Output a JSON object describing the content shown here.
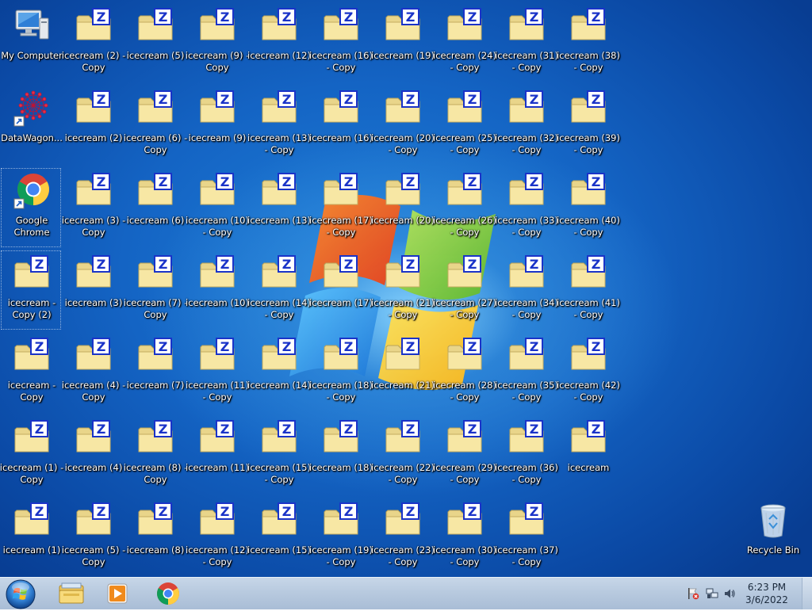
{
  "desktop": {
    "system_icons": [
      {
        "name": "my-computer-icon",
        "label": "My Computer",
        "glyph": "computer",
        "col": 0,
        "row": 0
      },
      {
        "name": "datawagon-shortcut-icon",
        "label": "DataWagon...",
        "glyph": "datawagon",
        "col": 0,
        "row": 1
      },
      {
        "name": "google-chrome-shortcut-icon",
        "label": "Google Chrome",
        "glyph": "chrome",
        "col": 0,
        "row": 2,
        "selected": true
      },
      {
        "name": "recycle-bin-icon",
        "label": "Recycle Bin",
        "glyph": "recycle-bin",
        "col": 12,
        "row": 6
      }
    ],
    "folder_glyph": "zip-folder-icon",
    "folders": [
      [
        {
          "col": 0,
          "row": 3,
          "label": "icecream - Copy (2)",
          "selected": true
        },
        {
          "col": 0,
          "row": 4,
          "label": "icecream - Copy"
        },
        {
          "col": 0,
          "row": 5,
          "label": "icecream (1) - Copy"
        },
        {
          "col": 0,
          "row": 6,
          "label": "icecream (1)"
        }
      ],
      [
        {
          "col": 1,
          "row": 0,
          "label": "icecream (2) - Copy"
        },
        {
          "col": 1,
          "row": 1,
          "label": "icecream (2)"
        },
        {
          "col": 1,
          "row": 2,
          "label": "icecream (3) - Copy"
        },
        {
          "col": 1,
          "row": 3,
          "label": "icecream (3)"
        },
        {
          "col": 1,
          "row": 4,
          "label": "icecream (4) - Copy"
        },
        {
          "col": 1,
          "row": 5,
          "label": "icecream (4)"
        },
        {
          "col": 1,
          "row": 6,
          "label": "icecream (5) - Copy"
        }
      ],
      [
        {
          "col": 2,
          "row": 0,
          "label": "icecream (5)"
        },
        {
          "col": 2,
          "row": 1,
          "label": "icecream (6) - Copy"
        },
        {
          "col": 2,
          "row": 2,
          "label": "icecream (6)"
        },
        {
          "col": 2,
          "row": 3,
          "label": "icecream (7) - Copy"
        },
        {
          "col": 2,
          "row": 4,
          "label": "icecream (7)"
        },
        {
          "col": 2,
          "row": 5,
          "label": "icecream (8) - Copy"
        },
        {
          "col": 2,
          "row": 6,
          "label": "icecream (8)"
        }
      ],
      [
        {
          "col": 3,
          "row": 0,
          "label": "icecream (9) - Copy"
        },
        {
          "col": 3,
          "row": 1,
          "label": "icecream (9)"
        },
        {
          "col": 3,
          "row": 2,
          "label": "icecream (10) - Copy"
        },
        {
          "col": 3,
          "row": 3,
          "label": "icecream (10)"
        },
        {
          "col": 3,
          "row": 4,
          "label": "icecream (11) - Copy"
        },
        {
          "col": 3,
          "row": 5,
          "label": "icecream (11)"
        },
        {
          "col": 3,
          "row": 6,
          "label": "icecream (12) - Copy"
        }
      ],
      [
        {
          "col": 4,
          "row": 0,
          "label": "icecream (12)"
        },
        {
          "col": 4,
          "row": 1,
          "label": "icecream (13) - Copy"
        },
        {
          "col": 4,
          "row": 2,
          "label": "icecream (13)"
        },
        {
          "col": 4,
          "row": 3,
          "label": "icecream (14) - Copy"
        },
        {
          "col": 4,
          "row": 4,
          "label": "icecream (14)"
        },
        {
          "col": 4,
          "row": 5,
          "label": "icecream (15) - Copy"
        },
        {
          "col": 4,
          "row": 6,
          "label": "icecream (15)"
        }
      ],
      [
        {
          "col": 5,
          "row": 0,
          "label": "icecream (16) - Copy"
        },
        {
          "col": 5,
          "row": 1,
          "label": "icecream (16)"
        },
        {
          "col": 5,
          "row": 2,
          "label": "icecream (17) - Copy"
        },
        {
          "col": 5,
          "row": 3,
          "label": "icecream (17)"
        },
        {
          "col": 5,
          "row": 4,
          "label": "icecream (18) - Copy"
        },
        {
          "col": 5,
          "row": 5,
          "label": "icecream (18)"
        },
        {
          "col": 5,
          "row": 6,
          "label": "icecream (19) - Copy"
        }
      ],
      [
        {
          "col": 6,
          "row": 0,
          "label": "icecream (19)"
        },
        {
          "col": 6,
          "row": 1,
          "label": "icecream (20) - Copy"
        },
        {
          "col": 6,
          "row": 2,
          "label": "icecream (20)"
        },
        {
          "col": 6,
          "row": 3,
          "label": "icecream (21) - Copy"
        },
        {
          "col": 6,
          "row": 4,
          "label": "icecream (21)"
        },
        {
          "col": 6,
          "row": 5,
          "label": "icecream (22) - Copy"
        },
        {
          "col": 6,
          "row": 6,
          "label": "icecream (23) - Copy"
        }
      ],
      [
        {
          "col": 7,
          "row": 0,
          "label": "icecream (24) - Copy"
        },
        {
          "col": 7,
          "row": 1,
          "label": "icecream (25) - Copy"
        },
        {
          "col": 7,
          "row": 2,
          "label": "icecream (26) - Copy"
        },
        {
          "col": 7,
          "row": 3,
          "label": "icecream (27) - Copy"
        },
        {
          "col": 7,
          "row": 4,
          "label": "icecream (28) - Copy"
        },
        {
          "col": 7,
          "row": 5,
          "label": "icecream (29) - Copy"
        },
        {
          "col": 7,
          "row": 6,
          "label": "icecream (30) - Copy"
        }
      ],
      [
        {
          "col": 8,
          "row": 0,
          "label": "icecream (31) - Copy"
        },
        {
          "col": 8,
          "row": 1,
          "label": "icecream (32) - Copy"
        },
        {
          "col": 8,
          "row": 2,
          "label": "icecream (33) - Copy"
        },
        {
          "col": 8,
          "row": 3,
          "label": "icecream (34) - Copy"
        },
        {
          "col": 8,
          "row": 4,
          "label": "icecream (35) - Copy"
        },
        {
          "col": 8,
          "row": 5,
          "label": "icecream (36) - Copy"
        },
        {
          "col": 8,
          "row": 6,
          "label": "icecream (37) - Copy"
        }
      ],
      [
        {
          "col": 9,
          "row": 0,
          "label": "icecream (38) - Copy"
        },
        {
          "col": 9,
          "row": 1,
          "label": "icecream (39) - Copy"
        },
        {
          "col": 9,
          "row": 2,
          "label": "icecream (40) - Copy"
        },
        {
          "col": 9,
          "row": 3,
          "label": "icecream (41) - Copy"
        },
        {
          "col": 9,
          "row": 4,
          "label": "icecream (42) - Copy"
        },
        {
          "col": 9,
          "row": 5,
          "label": "icecream"
        }
      ]
    ]
  },
  "taskbar": {
    "start_icon": "windows-start-orb",
    "pinned": [
      {
        "name": "windows-explorer-button",
        "icon": "folder-library-icon"
      },
      {
        "name": "media-player-button",
        "icon": "media-player-icon"
      },
      {
        "name": "chrome-taskbar-button",
        "icon": "chrome-icon"
      }
    ],
    "tray": {
      "icons": [
        "action-center-flag-icon",
        "network-icon",
        "volume-icon"
      ],
      "time": "6:23 PM",
      "date": "3/6/2022"
    }
  },
  "colors": {
    "taskbar": "#b8cadf",
    "desktop": "#1464c4",
    "folder": "#f4e39a",
    "zip_badge": "#1a33c8"
  }
}
